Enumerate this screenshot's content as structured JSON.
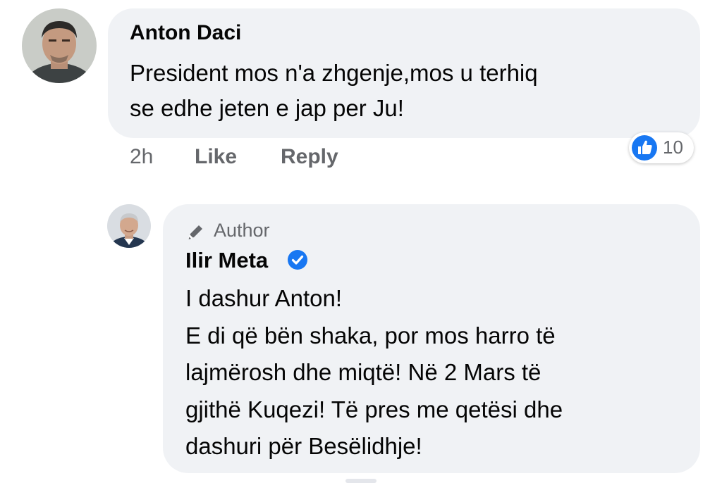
{
  "comment": {
    "author": "Anton Daci",
    "text": "President mos n'a zhgenje,mos u terhiq\nse edhe jeten e jap per Ju!",
    "time": "2h",
    "like_label": "Like",
    "reply_label": "Reply",
    "reaction_icon": "like-icon",
    "reaction_count": "10"
  },
  "reply": {
    "badge_icon": "pencil-icon",
    "badge_label": "Author",
    "author": "Ilir Meta",
    "verified_icon": "verified-badge-icon",
    "text": "I dashur Anton!\nE di që bën shaka, por mos harro të\nlajmërosh dhe miqtë! Në 2 Mars të\ngjithë Kuqezi! Të pres me qetësi dhe\ndashuri për Besëlidhje!"
  },
  "colors": {
    "bubble": "#f0f2f5",
    "secondary_text": "#65676b",
    "like_blue": "#1877f2",
    "verified_blue": "#1877f2"
  }
}
